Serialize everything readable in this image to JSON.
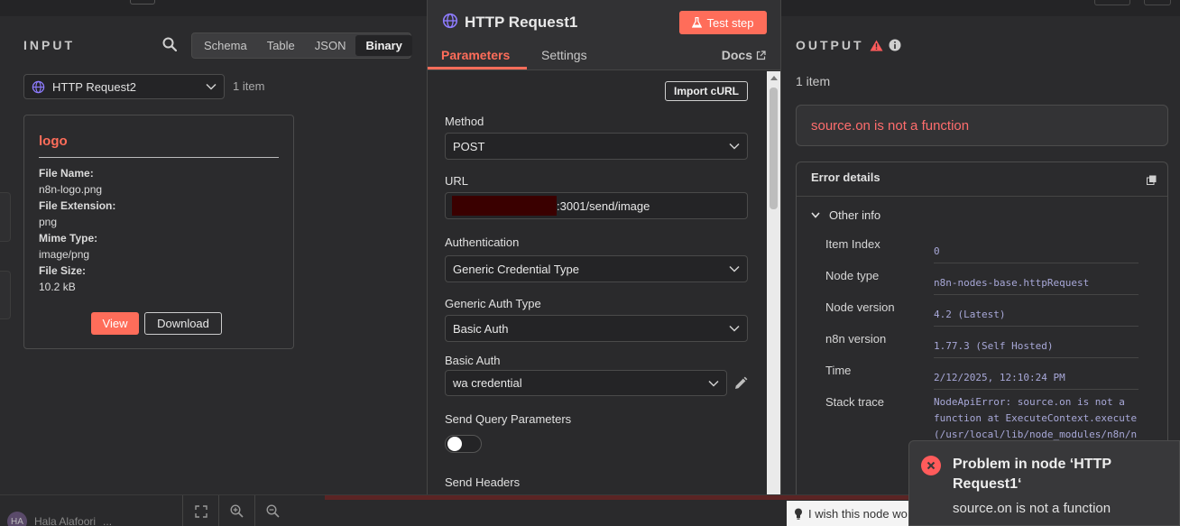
{
  "input": {
    "title": "INPUT",
    "views": [
      "Schema",
      "Table",
      "JSON",
      "Binary"
    ],
    "node_name": "HTTP Request2",
    "item_count": "1 item",
    "binary": {
      "title": "logo",
      "file_name_label": "File Name:",
      "file_name": "n8n-logo.png",
      "file_ext_label": "File Extension:",
      "file_ext": "png",
      "mime_label": "Mime Type:",
      "mime": "image/png",
      "size_label": "File Size:",
      "size": "10.2 kB",
      "view_label": "View",
      "download_label": "Download"
    }
  },
  "node": {
    "title": "HTTP Request1",
    "test_label": "Test step",
    "tabs": [
      "Parameters",
      "Settings"
    ],
    "docs_label": "Docs",
    "import_label": "Import cURL",
    "method_label": "Method",
    "method": "POST",
    "url_label": "URL",
    "url_suffix": ":3001/send/image",
    "auth_label": "Authentication",
    "auth": "Generic Credential Type",
    "generic_auth_label": "Generic Auth Type",
    "generic_auth": "Basic Auth",
    "basic_auth_label": "Basic Auth",
    "basic_auth": "wa credential",
    "query_label": "Send Query Parameters",
    "headers_label": "Send Headers"
  },
  "output": {
    "title": "OUTPUT",
    "item_count": "1 item",
    "error": "source.on is not a function",
    "details_title": "Error details",
    "other_info": "Other info",
    "rows": [
      {
        "k": "Item Index",
        "v": "0"
      },
      {
        "k": "Node type",
        "v": "n8n-nodes-base.httpRequest"
      },
      {
        "k": "Node version",
        "v": "4.2 (Latest)"
      },
      {
        "k": "n8n version",
        "v": "1.77.3 (Self Hosted)"
      },
      {
        "k": "Time",
        "v": "2/12/2025, 12:10:24 PM"
      },
      {
        "k": "Stack trace",
        "v1": "NodeApiError: source.on is not a",
        "v2": "function at ExecuteContext.execute",
        "v3": "(/usr/local/lib/node_modules/n8n/n"
      }
    ]
  },
  "toast": {
    "title": "Problem in node ‘HTTP Request1‘",
    "message": "source.on is not a function"
  },
  "footer": {
    "user_initials": "HA",
    "user_name": "Hala Alafoori",
    "user_more": "...",
    "wish_text": "I wish this node wo"
  },
  "colors": {
    "accent": "#ff6d5a",
    "error": "#ff6d6d",
    "toggle_on": "#20c35b"
  }
}
